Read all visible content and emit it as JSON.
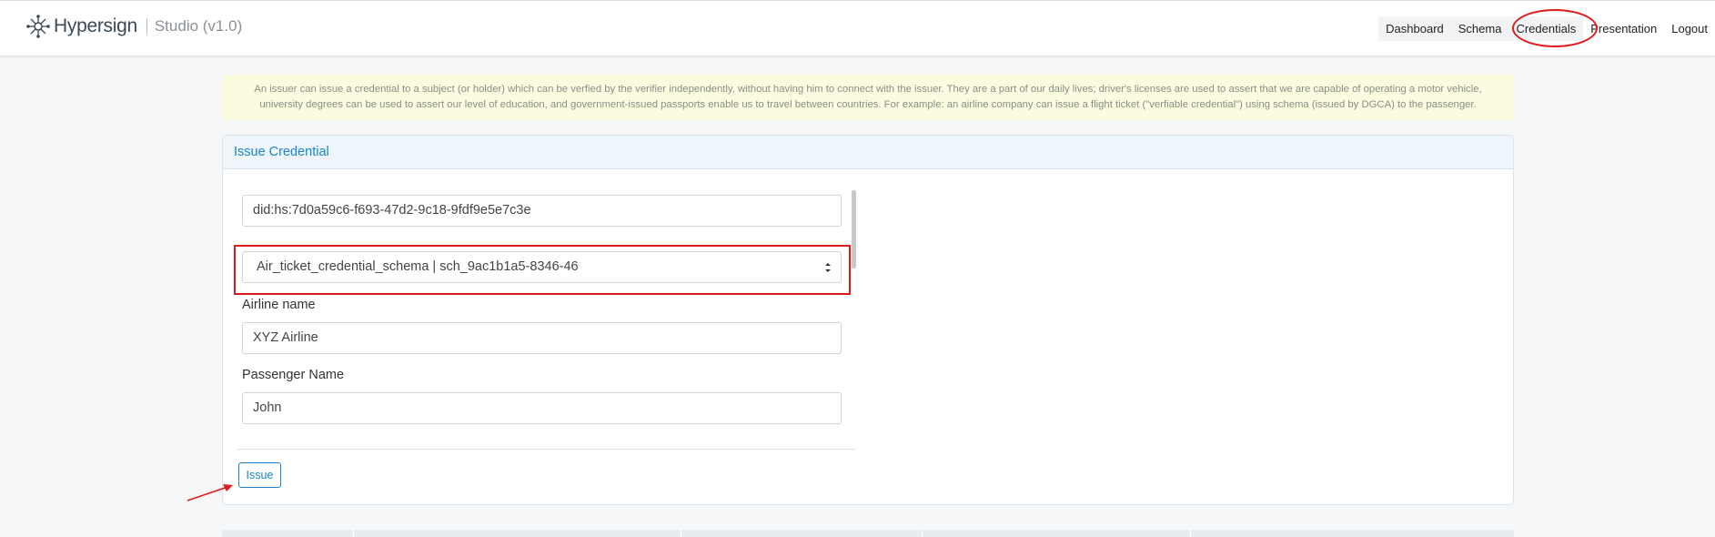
{
  "brand": {
    "name": "Hypersign",
    "studio": "Studio (v1.0)",
    "logo_icon": "hypersign-logo-icon"
  },
  "nav": {
    "dashboard": "Dashboard",
    "schema": "Schema",
    "credentials": "Credentials",
    "presentation": "Presentation",
    "logout": "Logout"
  },
  "info_text": "An issuer can issue a credential to a subject (or holder) which can be verfied by the verifier independently, without having him to connect with the issuer. They are a part of our daily lives; driver's licenses are used to assert that we are capable of operating a motor vehicle, university degrees can be used to assert our level of education, and government-issued passports enable us to travel between countries. For example: an airline company can issue a flight ticket (\"verfiable credential\") using schema (issued by DGCA) to the passenger.",
  "card": {
    "title": "Issue Credential",
    "did_value": "did:hs:7d0a59c6-f693-47d2-9c18-9fdf9e5e7c3e",
    "schema_selected": "Air_ticket_credential_schema | sch_9ac1b1a5-8346-46",
    "fields": [
      {
        "label": "Airline name",
        "value": "XYZ Airline"
      },
      {
        "label": "Passenger Name",
        "value": "John"
      }
    ],
    "issue_label": "Issue"
  },
  "colors": {
    "accent": "#1a86c9",
    "annotation": "#e01b1b",
    "banner": "#fbfbe0"
  }
}
